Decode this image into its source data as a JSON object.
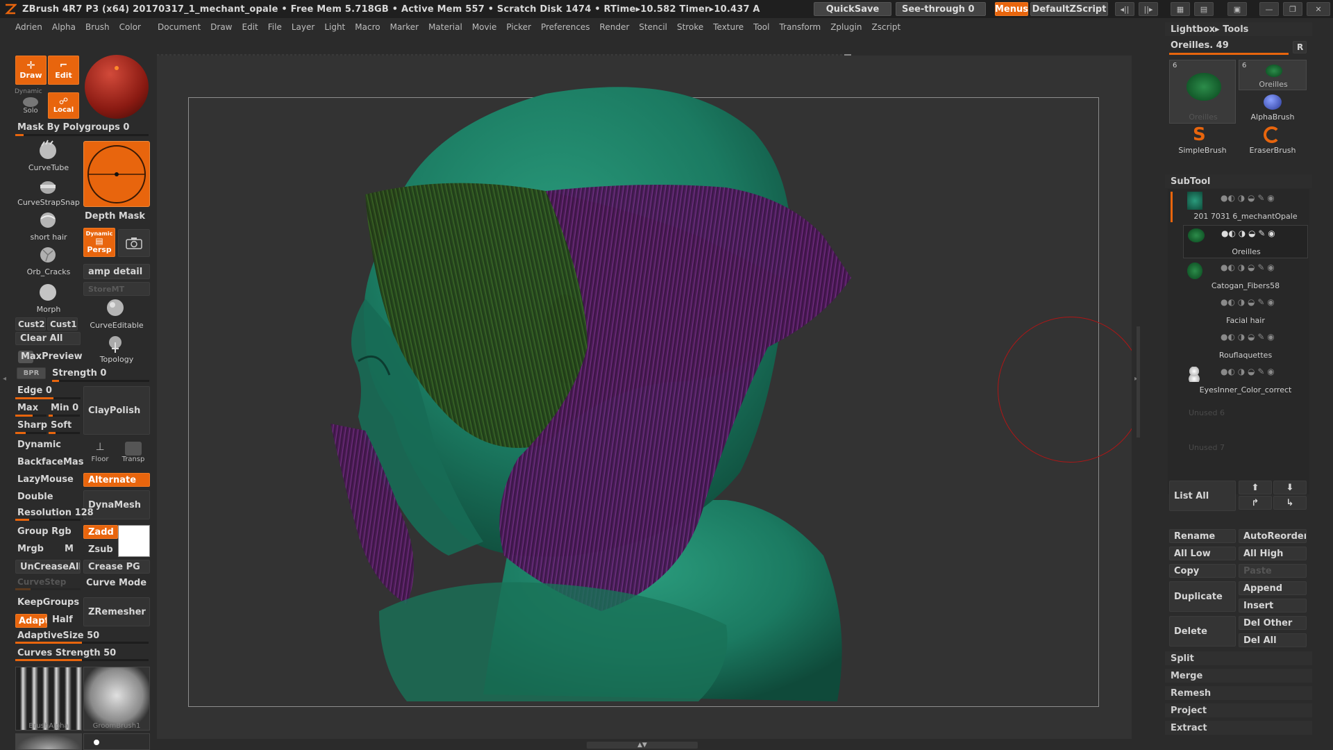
{
  "titlebar": {
    "title": "ZBrush 4R7 P3 (x64)  20170317_1_mechant_opale    • Free Mem 5.718GB • Active Mem 557 • Scratch Disk 1474 •  RTime▸10.582 Timer▸10.437 A",
    "quicksave": "QuickSave",
    "seethrough": "See-through  0",
    "menus": "Menus",
    "script": "DefaultZScript"
  },
  "menubar": [
    "Adrien",
    "Alpha",
    "Brush",
    "Color",
    "Document",
    "Draw",
    "Edit",
    "File",
    "Layer",
    "Light",
    "Macro",
    "Marker",
    "Material",
    "Movie",
    "Picker",
    "Preferences",
    "Render",
    "Stencil",
    "Stroke",
    "Texture",
    "Tool",
    "Transform",
    "Zplugin",
    "Zscript"
  ],
  "left": {
    "draw": "Draw",
    "edit": "Edit",
    "dynamic": "Dynamic",
    "solo": "Solo",
    "local": "Local",
    "mask_polygroups": "Mask By Polygroups 0",
    "brushes": [
      "CurveTube",
      "CurveStrapSnap",
      "short hair",
      "Orb_Cracks",
      "Morph"
    ],
    "depth_mask": "Depth Mask",
    "persp_dynamic": "Dynamic",
    "persp": "Persp",
    "amp_detail": "amp detail",
    "storemt": "StoreMT",
    "cust2": "Cust2",
    "cust1": "Cust1",
    "curve_editable": "CurveEditable",
    "clear_all": "Clear  All",
    "maxpreview": "MaxPreview",
    "topology": "Topology",
    "bpr": "BPR",
    "strength": "Strength 0",
    "edge": "Edge 0",
    "max": "Max",
    "min": "Min 0",
    "claypolish": "ClayPolish",
    "sharp": "Sharp",
    "soft": "Soft",
    "dynamic2": "Dynamic",
    "floor": "Floor",
    "transp": "Transp",
    "backfacemask": "BackfaceMas",
    "lazymouse": "LazyMouse",
    "alternate": "Alternate",
    "double": "Double",
    "dynamesh": "DynaMesh",
    "resolution": "Resolution 128",
    "group_rgb": "Group Rgb",
    "zadd": "Zadd",
    "mrgb": "Mrgb",
    "m": "M",
    "zsub": "Zsub",
    "uncreaseall": "UnCreaseAll",
    "crease_pg": "Crease PG",
    "curvestep": "CurveStep",
    "curve_mode": "Curve Mode",
    "keepgroups": "KeepGroups",
    "zremesher": "ZRemesher",
    "adapt": "Adapt",
    "half": "Half",
    "adaptivesize": "AdaptiveSize 50",
    "curves_strength": "Curves Strength 50",
    "brushalpha": "BrushAlpha",
    "groombrush": "GroomBrush1"
  },
  "right": {
    "lightbox_tools": "Lightbox▸ Tools",
    "current_tool": "Oreilles. 49",
    "r": "R",
    "thumbs": [
      {
        "num": "6",
        "label": "Oreilles"
      },
      {
        "num": "6",
        "label": "Oreilles"
      },
      {
        "label": "AlphaBrush"
      },
      {
        "label": "SimpleBrush"
      },
      {
        "label": "EraserBrush"
      }
    ],
    "subtool_header": "SubTool",
    "subtools": [
      "201 7031 6_mechantOpale",
      "Oreilles",
      "Catogan_Fibers58",
      "Facial hair",
      "Rouflaquettes",
      "EyesInner_Color_correct",
      "Unused 6",
      "Unused 7"
    ],
    "list_all": "List  All",
    "rename": "Rename",
    "autoreorder": "AutoReorder",
    "all_low": "All Low",
    "all_high": "All High",
    "copy": "Copy",
    "paste": "Paste",
    "duplicate": "Duplicate",
    "append": "Append",
    "insert": "Insert",
    "delete": "Delete",
    "del_other": "Del Other",
    "del_all": "Del All",
    "split": "Split",
    "merge": "Merge",
    "remesh": "Remesh",
    "project": "Project",
    "extract": "Extract"
  },
  "colors": {
    "accent": "#e8650d",
    "mesh": "#1f7a62",
    "hair_green": "#2f5a1c",
    "hair_purple": "#5a1e6a",
    "brush_ring": "#b01616"
  }
}
